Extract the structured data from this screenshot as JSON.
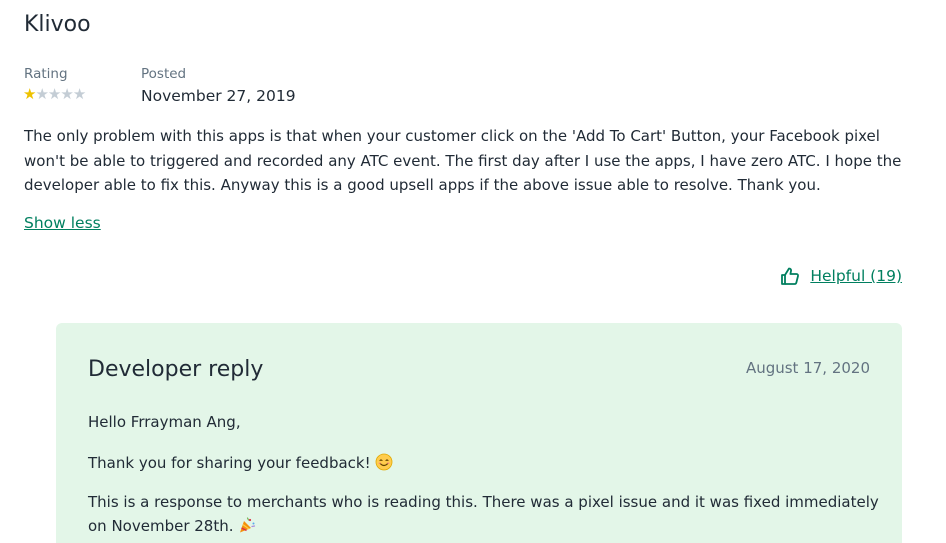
{
  "review": {
    "store_name": "Klivoo",
    "rating_label": "Rating",
    "posted_label": "Posted",
    "rating": 1,
    "rating_max": 5,
    "posted_date": "November 27, 2019",
    "body": "The only problem with this apps is that when your customer click on the 'Add To Cart' Button, your Facebook pixel won't be able to triggered and recorded any ATC event. The first day after I use the apps, I have zero ATC. I hope the developer able to fix this. Anyway this is a good upsell apps if the above issue able to resolve. Thank you.",
    "show_less_label": "Show less",
    "helpful_label": "Helpful (19)",
    "helpful_icon": "thumbs-up-icon"
  },
  "reply": {
    "title": "Developer reply",
    "date": "August 17, 2020",
    "greeting": "Hello Frrayman Ang,",
    "thanks": "Thank you for sharing your feedback!",
    "thanks_icon": "smiling-face-emoji",
    "message": "This is a response to merchants who is reading this. There was a pixel issue and it was fixed immediately on November 28th.",
    "message_icon": "party-popper-emoji"
  },
  "colors": {
    "accent": "#007f5f",
    "star": "#eec200",
    "reply_bg": "#e3f6e8",
    "muted": "#637381"
  }
}
